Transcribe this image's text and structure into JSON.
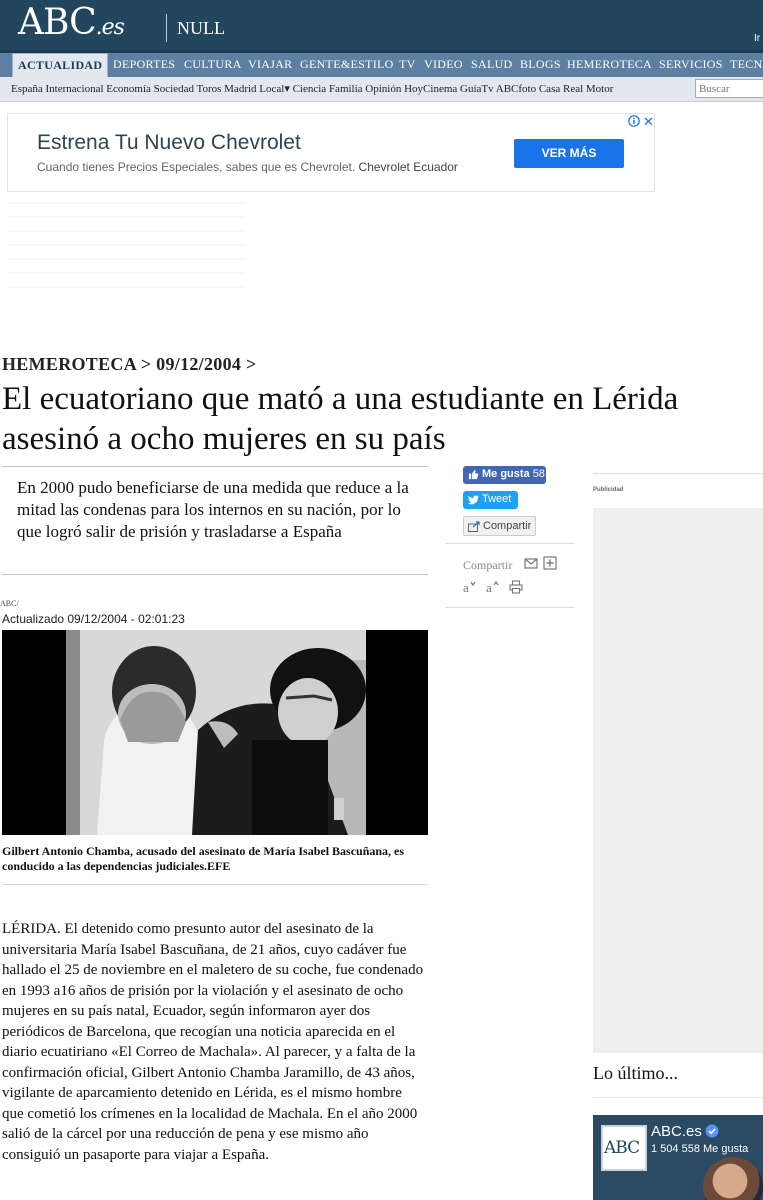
{
  "header": {
    "logo_main": "ABC",
    "logo_suffix": ".es",
    "section": "NULL",
    "ir_label": "Ir"
  },
  "main_nav": [
    {
      "label": "ACTUALIDAD",
      "active": true
    },
    {
      "label": "DEPORTES"
    },
    {
      "label": "CULTURA"
    },
    {
      "label": "VIAJAR"
    },
    {
      "label": "GENTE&ESTILO"
    },
    {
      "label": "TV"
    },
    {
      "label": "VIDEO"
    },
    {
      "label": "SALUD"
    },
    {
      "label": "BLOGS"
    },
    {
      "label": "HEMEROTECA"
    },
    {
      "label": "SERVICIOS"
    },
    {
      "label": "TECNO"
    }
  ],
  "sub_nav": {
    "links": "España Internacional Economía Sociedad Toros Madrid Local▾ Ciencia Familia Opinión HoyCinema GuíaTv ABCfoto Casa Real Motor",
    "search_placeholder": "Buscar"
  },
  "ad": {
    "title": "Estrena Tu Nuevo Chevrolet",
    "text": "Cuando tienes Precios Especiales, sabes que es Chevrolet.",
    "advertiser": "Chevrolet Ecuador",
    "button": "VER MÁS",
    "info_icon": "info-icon",
    "close_glyph": "✕"
  },
  "article": {
    "breadcrumb": "HEMEROTECA > 09/12/2004 >",
    "headline": "El ecuatoriano que mató a una estudiante en Lérida asesinó a ocho mujeres en su país",
    "lead": "En 2000 pudo beneficiarse de una medida que reduce a la mitad las condenas para los internos en su nación, por lo que logró salir de prisión y trasladarse a España",
    "byline": "ABC/",
    "updated": "Actualizado 09/12/2004 - 02:01:23",
    "caption": "Gilbert Antonio Chamba, acusado del asesinato de María Isabel Bascuñana, es conducido a las dependencias judiciales.EFE",
    "body": "LÉRIDA. El detenido como presunto autor del asesinato de la universitaria María Isabel Bascuñana, de 21 años, cuyo cadáver fue hallado el 25 de noviembre en el maletero de su coche, fue condenado en 1993 a16 años de prisión por la violación y el asesinato de ocho mujeres en su país natal, Ecuador, según informaron ayer dos periódicos de Barcelona, que recogían una noticia aparecida en el diario ecuatiriano «El Correo de Machala». Al parecer, y a falta de la confirmación oficial, Gilbert Antonio Chamba Jaramillo, de 43 años, vigilante de aparcamiento detenido en Lérida, es el mismo hombre que cometió los crímenes en la localidad de Machala. En el año 2000 salió de la cárcel por una reducción de pena y ese mismo año consiguió un pasaporte para viajar a España."
  },
  "share": {
    "like_label": "Me gusta",
    "like_count": "58",
    "tweet_label": "Tweet",
    "share_button": "Compartir",
    "share_label": "Compartir"
  },
  "sidebar": {
    "ad_label": "Publicidad",
    "latest_title": "Lo último...",
    "fb_page_name": "ABC.es",
    "fb_page_likes": "1 504 558 Me gusta",
    "fb_logo": "ABC"
  },
  "colors": {
    "header_bg": "#23465f",
    "nav_bg": "#5d7fa2",
    "subnav_bg": "#e3e8ee",
    "facebook": "#4267b2",
    "twitter": "#1da1f2",
    "ad_button": "#1a73e8"
  }
}
